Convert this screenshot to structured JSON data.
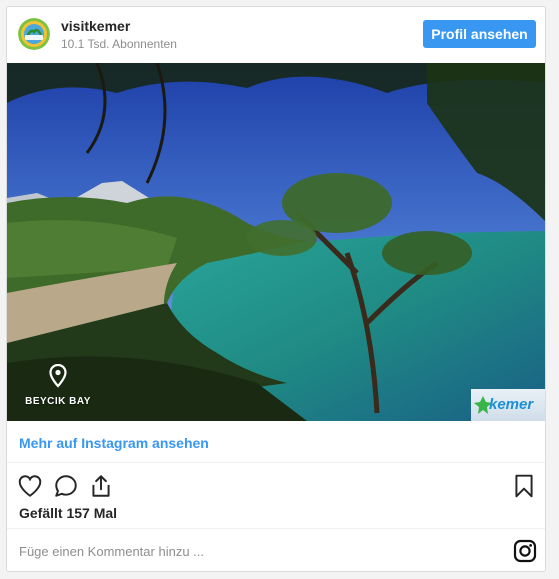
{
  "header": {
    "username": "visitkemer",
    "followers": "10.1 Tsd. Abonnenten",
    "profile_button": "Profil ansehen",
    "avatar_logo_text": "KEMER"
  },
  "photo": {
    "location_label": "BEYCIK BAY",
    "brand_logo": "kemer",
    "colors": {
      "sky": "#2f5fbf",
      "sea": "#1f8f8a",
      "forest": "#3f6b2a",
      "sand": "#b9a98a"
    }
  },
  "links": {
    "more_on_instagram": "Mehr auf Instagram ansehen"
  },
  "actions": {
    "like_icon": "heart-icon",
    "comment_icon": "comment-icon",
    "share_icon": "share-icon",
    "save_icon": "bookmark-icon"
  },
  "likes": "Gefällt 157 Mal",
  "comment": {
    "placeholder": "Füge einen Kommentar hinzu ..."
  },
  "accent": "#3897f0"
}
